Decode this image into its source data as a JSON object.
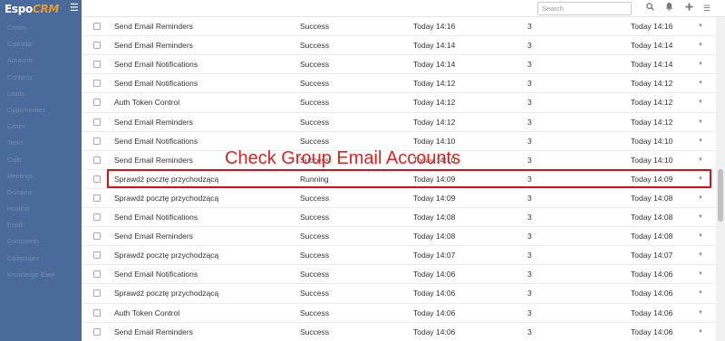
{
  "app": {
    "logo_main": "Espo",
    "logo_accent": "CRM"
  },
  "sidebar": {
    "items": [
      "Create",
      "Calendar",
      "Accounts",
      "Contacts",
      "Leads",
      "Opportunities",
      "Cases",
      "Tasks",
      "Calls",
      "Meetings",
      "Domains",
      "Hosting",
      "Email",
      "Documents",
      "Campaigns",
      "Knowledge Base"
    ]
  },
  "search": {
    "placeholder": "Search"
  },
  "icons": {
    "menu": "hamburger-icon",
    "search": "search-icon",
    "notifications": "bell-icon",
    "create": "plus-icon",
    "more": "menu-icon",
    "row_menu": "caret-down-icon"
  },
  "annotation": {
    "text": "Check Group Email Accounts",
    "color": "#e02020"
  },
  "jobs": [
    {
      "name": "Send Email Reminders",
      "status": "Success",
      "executed": "Today 14:16",
      "attempts": "3",
      "created": "Today 14:16"
    },
    {
      "name": "Send Email Reminders",
      "status": "Success",
      "executed": "Today 14:14",
      "attempts": "3",
      "created": "Today 14:14"
    },
    {
      "name": "Send Email Notifications",
      "status": "Success",
      "executed": "Today 14:14",
      "attempts": "3",
      "created": "Today 14:14"
    },
    {
      "name": "Send Email Notifications",
      "status": "Success",
      "executed": "Today 14:12",
      "attempts": "3",
      "created": "Today 14:12"
    },
    {
      "name": "Auth Token Control",
      "status": "Success",
      "executed": "Today 14:12",
      "attempts": "3",
      "created": "Today 14:12"
    },
    {
      "name": "Send Email Reminders",
      "status": "Success",
      "executed": "Today 14:12",
      "attempts": "3",
      "created": "Today 14:12"
    },
    {
      "name": "Send Email Notifications",
      "status": "Success",
      "executed": "Today 14:10",
      "attempts": "3",
      "created": "Today 14:10"
    },
    {
      "name": "Send Email Reminders",
      "status": "Success",
      "executed": "Today 14:10",
      "attempts": "3",
      "created": "Today 14:10"
    },
    {
      "name": "Sprawdź pocztę przychodzącą",
      "status": "Running",
      "executed": "Today 14:09",
      "attempts": "3",
      "created": "Today 14:09"
    },
    {
      "name": "Sprawdź pocztę przychodzącą",
      "status": "Success",
      "executed": "Today 14:09",
      "attempts": "3",
      "created": "Today 14:08"
    },
    {
      "name": "Send Email Notifications",
      "status": "Success",
      "executed": "Today 14:08",
      "attempts": "3",
      "created": "Today 14:08"
    },
    {
      "name": "Send Email Reminders",
      "status": "Success",
      "executed": "Today 14:08",
      "attempts": "3",
      "created": "Today 14:08"
    },
    {
      "name": "Sprawdź pocztę przychodzącą",
      "status": "Success",
      "executed": "Today 14:07",
      "attempts": "3",
      "created": "Today 14:07"
    },
    {
      "name": "Send Email Notifications",
      "status": "Success",
      "executed": "Today 14:06",
      "attempts": "3",
      "created": "Today 14:06"
    },
    {
      "name": "Sprawdź pocztę przychodzącą",
      "status": "Success",
      "executed": "Today 14:06",
      "attempts": "3",
      "created": "Today 14:06"
    },
    {
      "name": "Auth Token Control",
      "status": "Success",
      "executed": "Today 14:06",
      "attempts": "3",
      "created": "Today 14:06"
    },
    {
      "name": "Send Email Reminders",
      "status": "Success",
      "executed": "Today 14:06",
      "attempts": "3",
      "created": "Today 14:06"
    }
  ]
}
